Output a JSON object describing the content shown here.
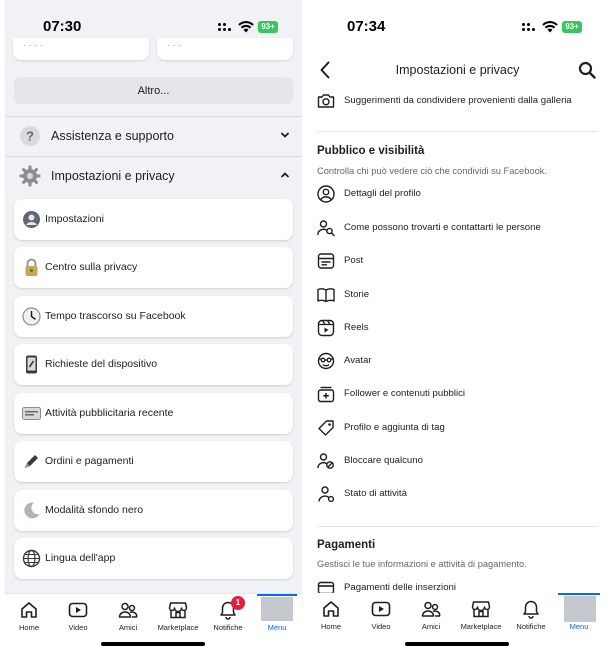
{
  "left_phone": {
    "status": {
      "time": "07:30",
      "battery": "93+"
    },
    "altro_label": "Altro...",
    "sections": [
      {
        "label": "Assistenza e supporto",
        "icon": "help-icon",
        "expanded": false
      },
      {
        "label": "Impostazioni e privacy",
        "icon": "gear-icon",
        "expanded": true
      }
    ],
    "menu_items": [
      {
        "label": "Impostazioni",
        "icon": "user-settings-icon"
      },
      {
        "label": "Centro sulla privacy",
        "icon": "lock-icon"
      },
      {
        "label": "Tempo trascorso su Facebook",
        "icon": "clock-icon"
      },
      {
        "label": "Richieste del dispositivo",
        "icon": "phone-device-icon"
      },
      {
        "label": "Attività pubblicitaria recente",
        "icon": "ad-activity-icon"
      },
      {
        "label": "Ordini e pagamenti",
        "icon": "pen-icon"
      },
      {
        "label": "Modalità sfondo nero",
        "icon": "moon-icon"
      },
      {
        "label": "Lingua dell'app",
        "icon": "globe-icon"
      }
    ],
    "tabbar": [
      {
        "label": "Home",
        "icon": "home-icon"
      },
      {
        "label": "Video",
        "icon": "video-icon"
      },
      {
        "label": "Amici",
        "icon": "friends-icon"
      },
      {
        "label": "Marketplace",
        "icon": "marketplace-icon"
      },
      {
        "label": "Notifiche",
        "icon": "bell-icon",
        "badge": "1"
      },
      {
        "label": "Menu",
        "icon": "avatar-icon",
        "active": true
      }
    ]
  },
  "right_phone": {
    "status": {
      "time": "07:34",
      "battery": "93+"
    },
    "header": {
      "title": "Impostazioni e privacy"
    },
    "top_item": {
      "label": "Suggerimenti da condividere provenienti dalla galleria",
      "icon": "camera-icon"
    },
    "public_section": {
      "title": "Pubblico e visibilità",
      "description": "Controlla chi può vedere ciò che condividi su Facebook.",
      "items": [
        {
          "label": "Dettagli del profilo",
          "icon": "profile-circle-icon"
        },
        {
          "label": "Come possono trovarti e contattarti le persone",
          "icon": "person-search-icon"
        },
        {
          "label": "Post",
          "icon": "post-icon"
        },
        {
          "label": "Storie",
          "icon": "book-icon"
        },
        {
          "label": "Reels",
          "icon": "reels-icon"
        },
        {
          "label": "Avatar",
          "icon": "avatar-face-icon"
        },
        {
          "label": "Follower e contenuti pubblici",
          "icon": "follower-icon"
        },
        {
          "label": "Profilo e aggiunta di tag",
          "icon": "tag-icon"
        },
        {
          "label": "Bloccare qualcuno",
          "icon": "block-user-icon"
        },
        {
          "label": "Stato di attività",
          "icon": "activity-status-icon"
        }
      ]
    },
    "payments_section": {
      "title": "Pagamenti",
      "description": "Gestisci le tue informazioni e attività di pagamento.",
      "items": [
        {
          "label": "Pagamenti delle inserzioni",
          "icon": "card-icon"
        }
      ]
    },
    "tabbar": [
      {
        "label": "Home",
        "icon": "home-icon"
      },
      {
        "label": "Video",
        "icon": "video-icon"
      },
      {
        "label": "Amici",
        "icon": "friends-icon"
      },
      {
        "label": "Marketplace",
        "icon": "marketplace-icon"
      },
      {
        "label": "Notifiche",
        "icon": "bell-icon"
      },
      {
        "label": "Menu",
        "icon": "avatar-icon",
        "active": true
      }
    ]
  },
  "colors": {
    "accent": "#0866ff",
    "badge": "#e41e3f",
    "battery": "#34c759",
    "left_bg": "#f0f2f5"
  }
}
